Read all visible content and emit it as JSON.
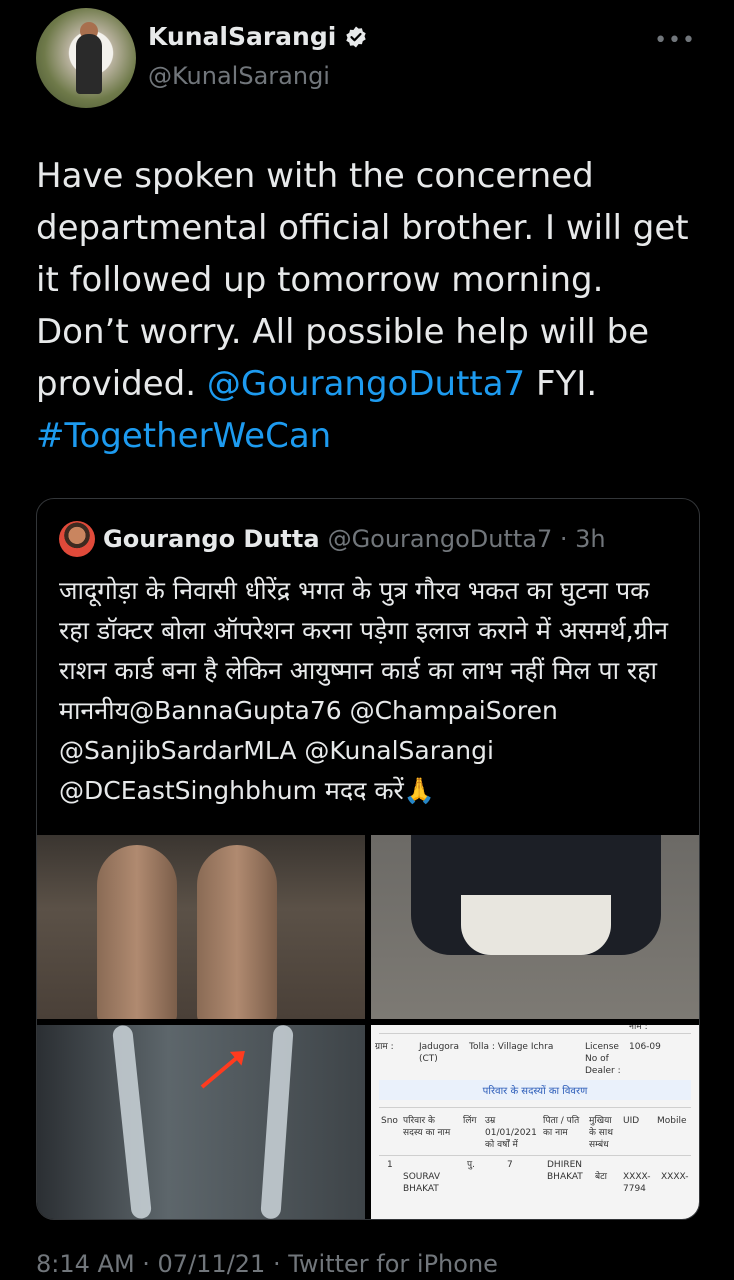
{
  "author": {
    "name": "KunalSarangi",
    "handle": "@KunalSarangi",
    "verified": true,
    "avatar_icon": "profile-photo"
  },
  "more_label": "•••",
  "tweet": {
    "text_1": "Have spoken with the concerned departmental official brother. I will get it followed up tomorrow morning. Don’t worry. All possible help will be provided. ",
    "mention": "@GourangoDutta7",
    "text_2": " FYI.",
    "hashtag": "#TogetherWeCan"
  },
  "quote": {
    "name": "Gourango Dutta",
    "handle_time": "@GourangoDutta7 · 3h",
    "text": "जादूगोड़ा के निवासी धीरेंद्र भगत के पुत्र गौरव भकत का घुटना पक रहा डॉक्टर बोला ऑपरेशन करना पड़ेगा इलाज कराने में असमर्थ,ग्रीन राशन कार्ड बना है लेकिन आयुष्मान कार्ड का लाभ नहीं मिल पा रहा माननीय@BannaGupta76 @ChampaiSoren @SanjibSardarMLA @KunalSarangi @DCEastSinghbhum मदद करें🙏",
    "media": {
      "document": {
        "top_label": "नाम :",
        "gram_label": "ग्राम :",
        "gram_value": "Jadugora (CT)",
        "tolla": "Tolla : Village Ichra",
        "license_label": "License No of Dealer :",
        "license_value": "106-09",
        "section_title": "परिवार के सदस्यों का विवरण",
        "headers": [
          "Sno",
          "परिवार के सदस्य का नाम",
          "लिंग",
          "उम्र 01/01/2021 को वर्षों में",
          "पिता / पति का नाम",
          "मुखिया के साथ सम्बंध",
          "UID",
          "Mobile"
        ],
        "row": [
          "1",
          "SOURAV BHAKAT",
          "पु.",
          "7",
          "DHIREN BHAKAT",
          "बेटा",
          "XXXX-7794",
          "XXXX-"
        ]
      }
    }
  },
  "footer": "8:14 AM · 07/11/21 · Twitter for iPhone",
  "colors": {
    "link": "#1d9bf0",
    "background": "#000000",
    "muted": "#71767b"
  }
}
